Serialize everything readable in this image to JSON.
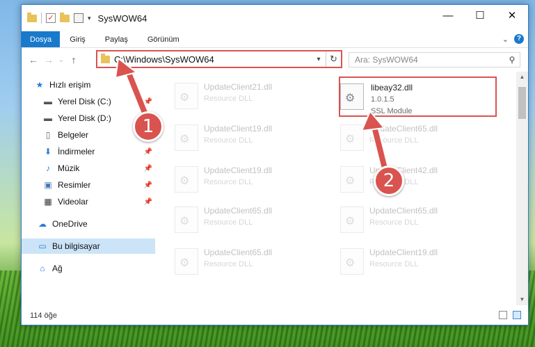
{
  "window": {
    "title": "SysWOW64"
  },
  "winctl": {
    "minimize": "—",
    "maximize": "☐",
    "close": "✕"
  },
  "ribbon": {
    "tabs": [
      "Dosya",
      "Giriş",
      "Paylaş",
      "Görünüm"
    ],
    "help": "?"
  },
  "nav": {
    "back": "←",
    "forward": "→",
    "recent": "⌄",
    "up": "↑",
    "address": "C:\\Windows\\SysWOW64",
    "search_placeholder": "Ara: SysWOW64"
  },
  "sidebar": {
    "items": [
      {
        "label": "Hızlı erişim",
        "icon": "star-icon",
        "glyph": "★",
        "color": "#2b7bd6"
      },
      {
        "label": "Yerel Disk (C:)",
        "icon": "drive-icon",
        "glyph": "▬",
        "color": "#555"
      },
      {
        "label": "Yerel Disk (D:)",
        "icon": "drive-icon",
        "glyph": "▬",
        "color": "#555"
      },
      {
        "label": "Belgeler",
        "icon": "document-icon",
        "glyph": "▯",
        "color": "#666"
      },
      {
        "label": "İndirmeler",
        "icon": "download-icon",
        "glyph": "⬇",
        "color": "#2b7bd6"
      },
      {
        "label": "Müzik",
        "icon": "music-icon",
        "glyph": "♪",
        "color": "#2b7bd6"
      },
      {
        "label": "Resimler",
        "icon": "pictures-icon",
        "glyph": "▣",
        "color": "#4a7ab0"
      },
      {
        "label": "Videolar",
        "icon": "video-icon",
        "glyph": "▦",
        "color": "#333"
      },
      {
        "label": "OneDrive",
        "icon": "cloud-icon",
        "glyph": "☁",
        "color": "#2b7bd6"
      },
      {
        "label": "Bu bilgisayar",
        "icon": "computer-icon",
        "glyph": "▭",
        "color": "#2b7bd6"
      },
      {
        "label": "Ağ",
        "icon": "network-icon",
        "glyph": "⌂",
        "color": "#2b7bd6"
      }
    ]
  },
  "files": {
    "left": [
      {
        "name": "UpdateClient21.dll",
        "type": "Resource DLL"
      },
      {
        "name": "UpdateClient19.dll",
        "type": "Resource DLL"
      },
      {
        "name": "UpdateClient19.dll",
        "type": "Resource DLL"
      },
      {
        "name": "UpdateClient65.dll",
        "type": "Resource DLL"
      },
      {
        "name": "UpdateClient65.dll",
        "type": "Resource DLL"
      }
    ],
    "right": [
      {
        "name": "libeay32.dll",
        "version": "1.0.1.5",
        "type": "SSL Module"
      },
      {
        "name": "UpdateClient65.dll",
        "type": "Resource DLL"
      },
      {
        "name": "UpdateClient42.dll",
        "type": "Resource DLL"
      },
      {
        "name": "UpdateClient65.dll",
        "type": "Resource DLL"
      },
      {
        "name": "UpdateClient19.dll",
        "type": "Resource DLL"
      }
    ]
  },
  "status": {
    "count": "114 öğe"
  },
  "annotations": {
    "step1": "1",
    "step2": "2",
    "color": "#d9534f"
  }
}
